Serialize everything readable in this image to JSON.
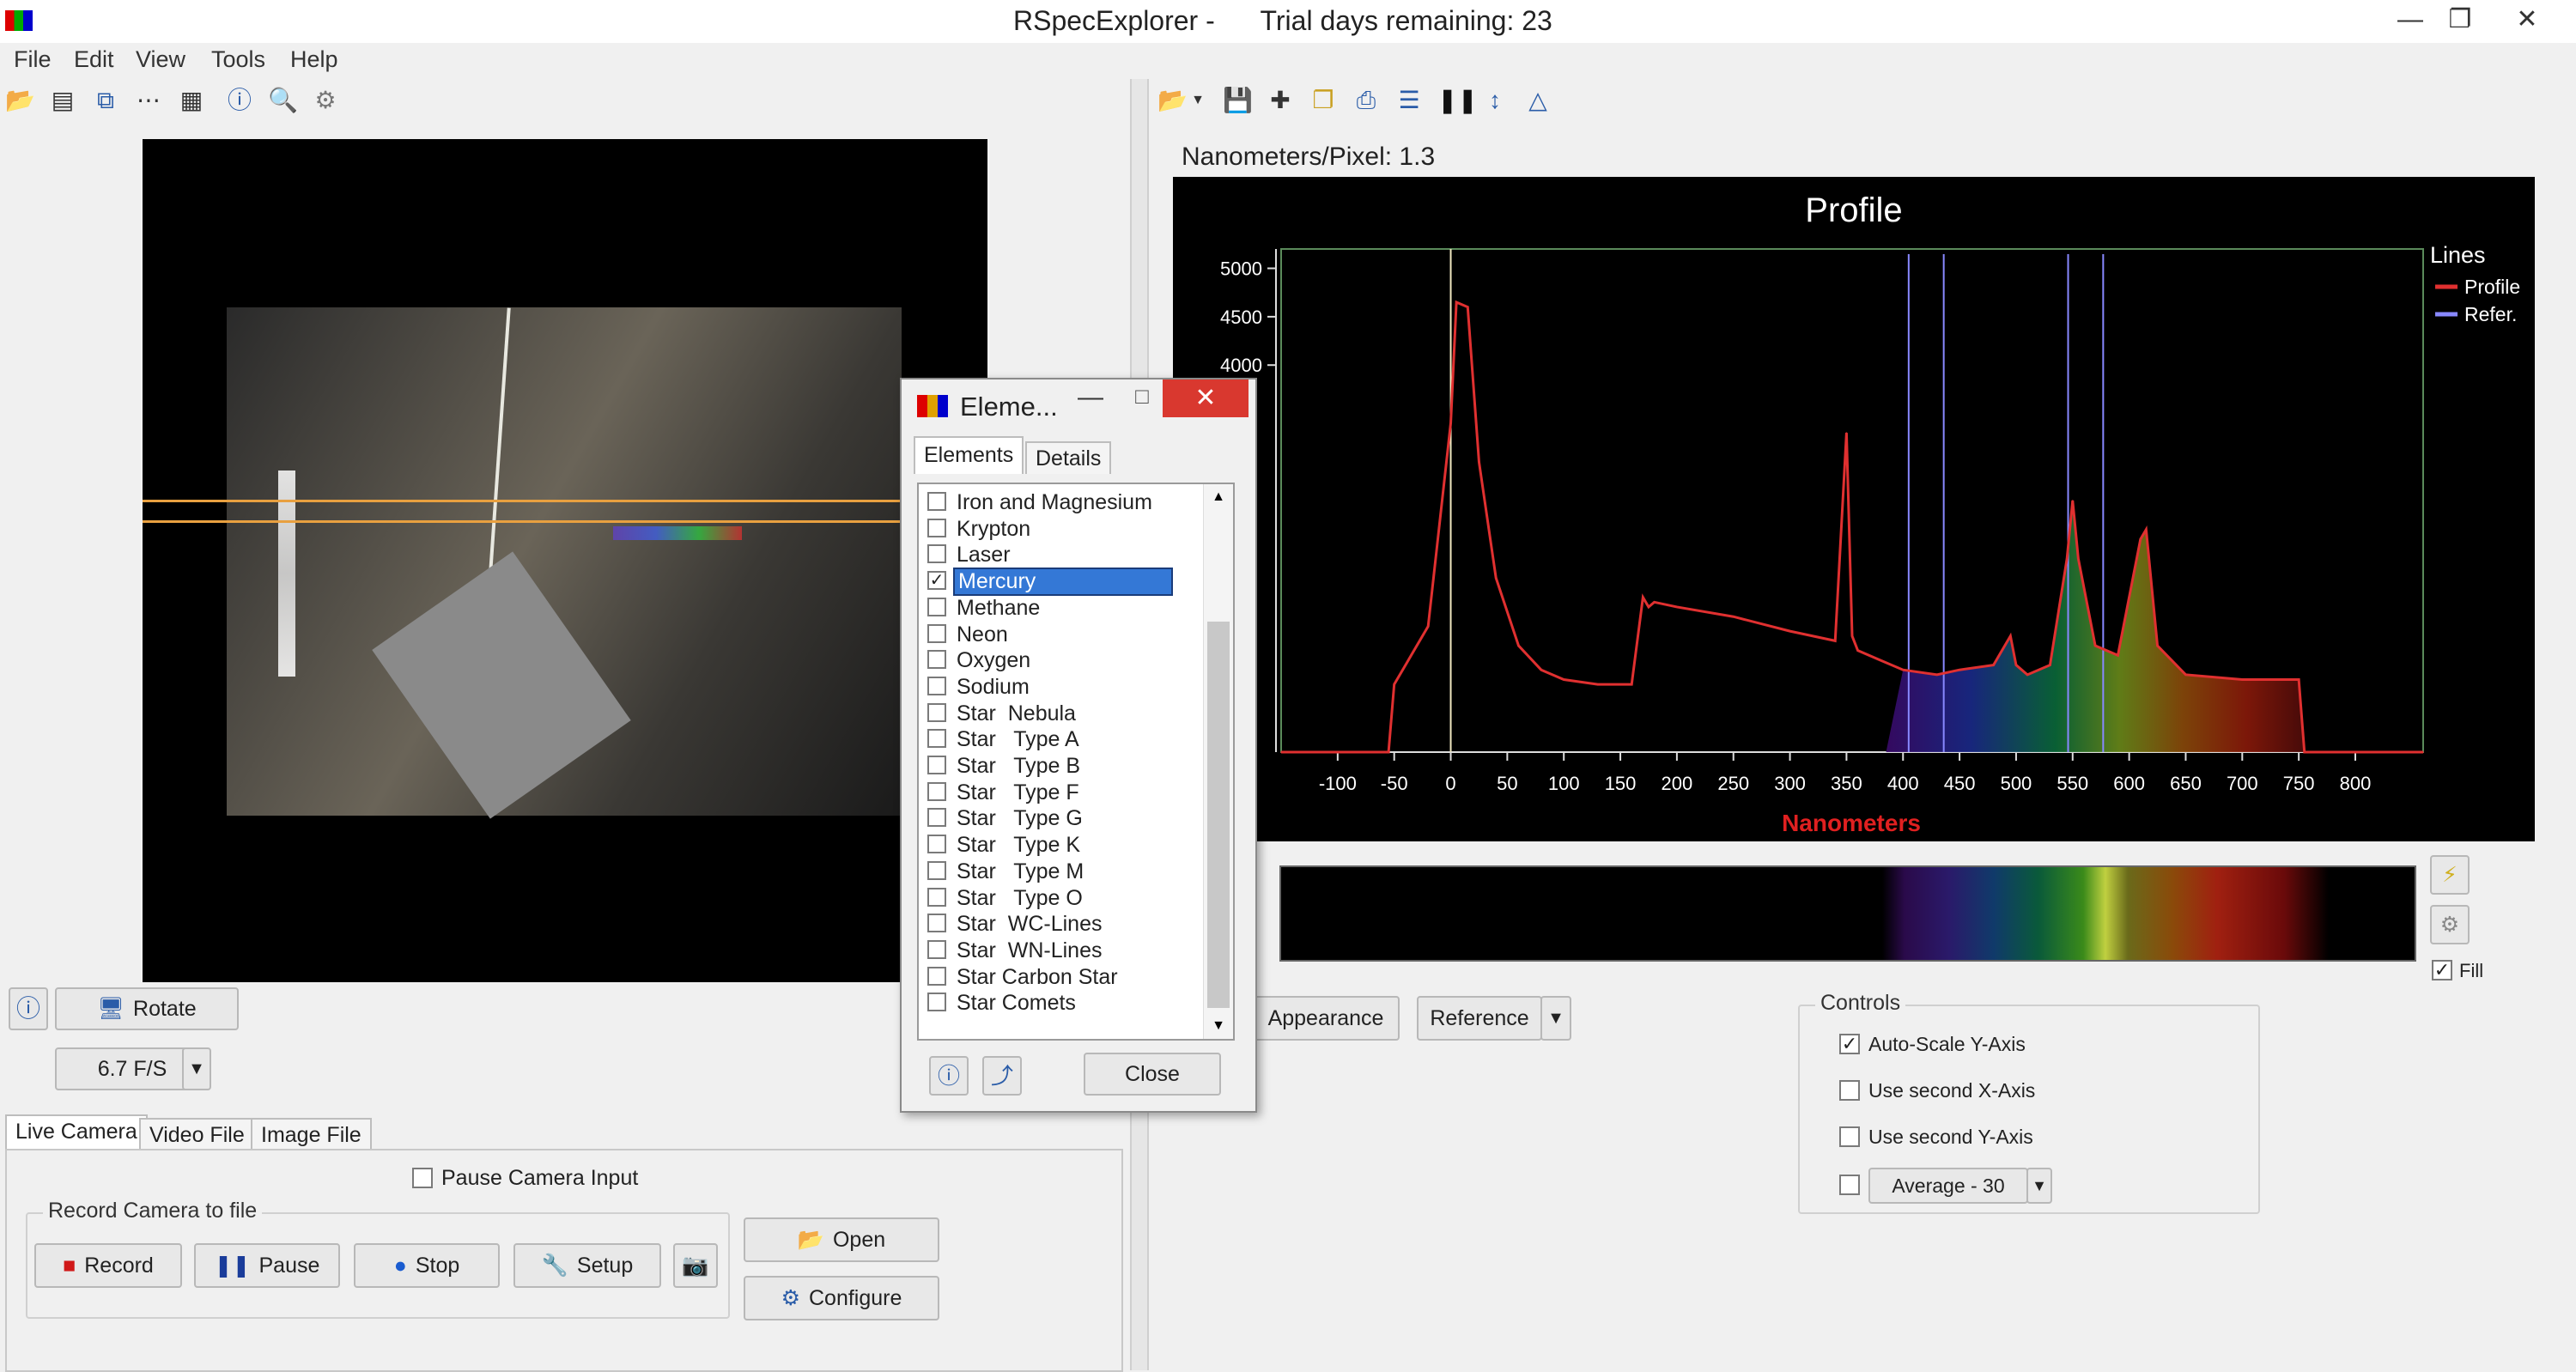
{
  "window": {
    "title": "RSpecExplorer -      Trial days remaining: 23",
    "minimize": "—",
    "maximize": "❐",
    "close": "✕"
  },
  "menu": [
    "File",
    "Edit",
    "View",
    "Tools",
    "Help"
  ],
  "left_toolbar_icons": [
    "open-folder-icon",
    "spectrum-icon",
    "windows-icon",
    "dots-icon",
    "grid-icon",
    "help-icon",
    "zoom-icon",
    "gear-icon"
  ],
  "right_toolbar_icons": [
    "open-folder-icon",
    "dropdown-icon",
    "save-icon",
    "crop-icon",
    "copy-icon",
    "print-icon",
    "calibrate-icon",
    "bars-icon",
    "vertical-range-icon",
    "horizontal-range-icon"
  ],
  "camera_controls": {
    "rotate_label": "Rotate",
    "fps_value": "6.7 F/S",
    "tabs": [
      "Live Camera",
      "Video File",
      "Image File"
    ],
    "pause_camera_input": "Pause Camera Input",
    "record_group_label": "Record Camera to file",
    "record": "Record",
    "pause": "Pause",
    "stop": "Stop",
    "setup": "Setup",
    "open": "Open",
    "configure": "Configure"
  },
  "nm_per_pixel": "Nanometers/Pixel: 1.3",
  "chart_data": {
    "type": "line",
    "title": "Profile",
    "xlabel": "Nanometers",
    "ylabel": "",
    "xlim": [
      -150,
      860
    ],
    "ylim": [
      0,
      5200
    ],
    "x_ticks": [
      -100,
      -50,
      0,
      50,
      100,
      150,
      200,
      250,
      300,
      350,
      400,
      450,
      500,
      550,
      600,
      650,
      700,
      750,
      800
    ],
    "y_ticks": [
      4000,
      4500,
      5000
    ],
    "legend_title": "Lines",
    "legend_position": "top-right",
    "legend": [
      "Profile",
      "Refer."
    ],
    "series": [
      {
        "name": "Profile",
        "color": "#e03030",
        "x": [
          -150,
          -55,
          -50,
          -40,
          -20,
          0,
          5,
          15,
          25,
          40,
          60,
          80,
          100,
          130,
          160,
          170,
          175,
          180,
          200,
          250,
          300,
          340,
          350,
          355,
          360,
          380,
          400,
          430,
          450,
          480,
          495,
          500,
          510,
          530,
          545,
          550,
          555,
          570,
          590,
          610,
          615,
          625,
          650,
          700,
          750,
          755,
          760,
          860
        ],
        "values": [
          0,
          0,
          700,
          900,
          1300,
          3400,
          4650,
          4600,
          3000,
          1800,
          1100,
          850,
          750,
          700,
          700,
          1600,
          1500,
          1550,
          1500,
          1400,
          1250,
          1150,
          3300,
          1200,
          1050,
          950,
          850,
          800,
          850,
          900,
          1200,
          900,
          800,
          900,
          2000,
          2600,
          2000,
          1100,
          1000,
          2200,
          2300,
          1100,
          800,
          750,
          750,
          0,
          0,
          0
        ]
      },
      {
        "name": "Refer.",
        "color": "#8888ff",
        "lines_at": [
          405,
          436,
          546,
          577
        ]
      }
    ],
    "annotation": {
      "vertical_marker_x": 0
    }
  },
  "below_chart": {
    "appearance": "Appearance",
    "reference": "Reference",
    "fill_label": "Fill",
    "fill_checked": true,
    "controls_label": "Controls",
    "auto_scale_y": "Auto-Scale Y-Axis",
    "auto_scale_checked": true,
    "second_x": "Use second X-Axis",
    "second_y": "Use second Y-Axis",
    "average_value": "Average - 30"
  },
  "dialog": {
    "title": "Eleme...",
    "tabs": [
      "Elements",
      "Details"
    ],
    "items": [
      {
        "label": "Iron and Magnesium",
        "checked": false
      },
      {
        "label": "Krypton",
        "checked": false
      },
      {
        "label": "Laser",
        "checked": false
      },
      {
        "label": "Mercury",
        "checked": true,
        "selected": true
      },
      {
        "label": "Methane",
        "checked": false
      },
      {
        "label": "Neon",
        "checked": false
      },
      {
        "label": "Oxygen",
        "checked": false
      },
      {
        "label": "Sodium",
        "checked": false
      },
      {
        "label": "Star  Nebula",
        "checked": false
      },
      {
        "label": "Star   Type A",
        "checked": false
      },
      {
        "label": "Star   Type B",
        "checked": false
      },
      {
        "label": "Star   Type F",
        "checked": false
      },
      {
        "label": "Star   Type G",
        "checked": false
      },
      {
        "label": "Star   Type K",
        "checked": false
      },
      {
        "label": "Star   Type M",
        "checked": false
      },
      {
        "label": "Star   Type O",
        "checked": false
      },
      {
        "label": "Star  WC-Lines",
        "checked": false
      },
      {
        "label": "Star  WN-Lines",
        "checked": false
      },
      {
        "label": "Star Carbon Star",
        "checked": false
      },
      {
        "label": "Star Comets",
        "checked": false
      }
    ],
    "close": "Close"
  }
}
